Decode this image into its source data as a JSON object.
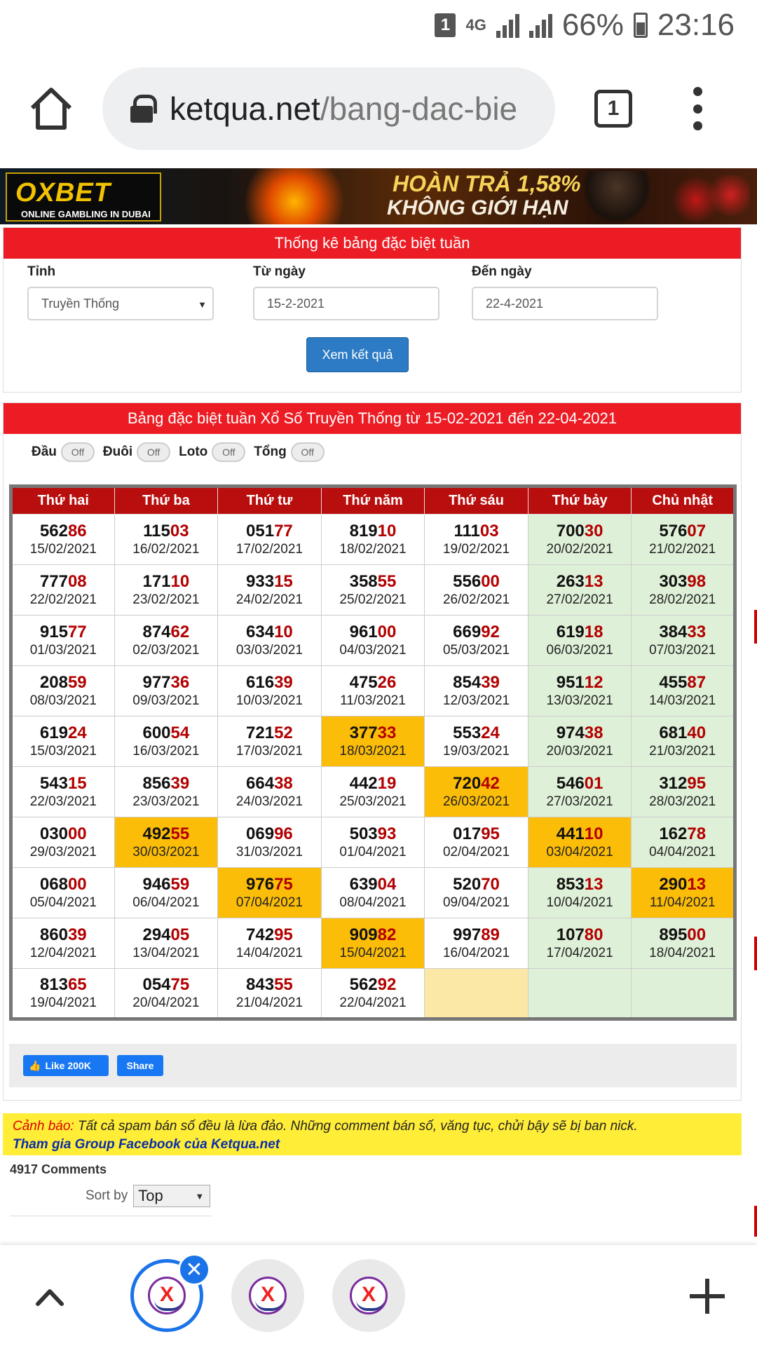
{
  "status_bar": {
    "notification_count": "1",
    "network": "4G",
    "battery": "66%",
    "time": "23:16"
  },
  "browser": {
    "url_host": "ketqua.net",
    "url_path": "/bang-dac-bie",
    "tab_count": "1"
  },
  "banner": {
    "brand": "OXBET",
    "tagline": "ONLINE GAMBLING IN DUBAI",
    "headline1": "HOÀN TRẢ 1,58%",
    "headline2": "KHÔNG GIỚI HẠN"
  },
  "filter": {
    "title": "Thống kê bảng đặc biệt tuần",
    "province_label": "Tỉnh",
    "province_value": "Truyền Thống",
    "from_label": "Từ ngày",
    "from_value": "15-2-2021",
    "to_label": "Đến ngày",
    "to_value": "22-4-2021",
    "submit_label": "Xem kết quả"
  },
  "results": {
    "title": "Bảng đặc biệt tuần Xổ Số Truyền Thống từ 15-02-2021 đến 22-04-2021",
    "toggles": [
      {
        "label": "Đầu",
        "state": "Off"
      },
      {
        "label": "Đuôi",
        "state": "Off"
      },
      {
        "label": "Loto",
        "state": "Off"
      },
      {
        "label": "Tổng",
        "state": "Off"
      }
    ],
    "headers": [
      "Thứ hai",
      "Thứ ba",
      "Thứ tư",
      "Thứ năm",
      "Thứ sáu",
      "Thứ bảy",
      "Chủ nhật"
    ],
    "rows": [
      [
        {
          "n": "56286",
          "d": "15/02/2021"
        },
        {
          "n": "11503",
          "d": "16/02/2021"
        },
        {
          "n": "05177",
          "d": "17/02/2021"
        },
        {
          "n": "81910",
          "d": "18/02/2021"
        },
        {
          "n": "11103",
          "d": "19/02/2021"
        },
        {
          "n": "70030",
          "d": "20/02/2021"
        },
        {
          "n": "57607",
          "d": "21/02/2021"
        }
      ],
      [
        {
          "n": "77708",
          "d": "22/02/2021"
        },
        {
          "n": "17110",
          "d": "23/02/2021"
        },
        {
          "n": "93315",
          "d": "24/02/2021"
        },
        {
          "n": "35855",
          "d": "25/02/2021"
        },
        {
          "n": "55600",
          "d": "26/02/2021"
        },
        {
          "n": "26313",
          "d": "27/02/2021"
        },
        {
          "n": "30398",
          "d": "28/02/2021"
        }
      ],
      [
        {
          "n": "91577",
          "d": "01/03/2021"
        },
        {
          "n": "87462",
          "d": "02/03/2021"
        },
        {
          "n": "63410",
          "d": "03/03/2021"
        },
        {
          "n": "96100",
          "d": "04/03/2021"
        },
        {
          "n": "66992",
          "d": "05/03/2021"
        },
        {
          "n": "61918",
          "d": "06/03/2021"
        },
        {
          "n": "38433",
          "d": "07/03/2021"
        }
      ],
      [
        {
          "n": "20859",
          "d": "08/03/2021"
        },
        {
          "n": "97736",
          "d": "09/03/2021"
        },
        {
          "n": "61639",
          "d": "10/03/2021"
        },
        {
          "n": "47526",
          "d": "11/03/2021"
        },
        {
          "n": "85439",
          "d": "12/03/2021"
        },
        {
          "n": "95112",
          "d": "13/03/2021"
        },
        {
          "n": "45587",
          "d": "14/03/2021"
        }
      ],
      [
        {
          "n": "61924",
          "d": "15/03/2021"
        },
        {
          "n": "60054",
          "d": "16/03/2021"
        },
        {
          "n": "72152",
          "d": "17/03/2021"
        },
        {
          "n": "37733",
          "d": "18/03/2021",
          "hl": true
        },
        {
          "n": "55324",
          "d": "19/03/2021"
        },
        {
          "n": "97438",
          "d": "20/03/2021"
        },
        {
          "n": "68140",
          "d": "21/03/2021"
        }
      ],
      [
        {
          "n": "54315",
          "d": "22/03/2021"
        },
        {
          "n": "85639",
          "d": "23/03/2021"
        },
        {
          "n": "66438",
          "d": "24/03/2021"
        },
        {
          "n": "44219",
          "d": "25/03/2021"
        },
        {
          "n": "72042",
          "d": "26/03/2021",
          "hl": true
        },
        {
          "n": "54601",
          "d": "27/03/2021"
        },
        {
          "n": "31295",
          "d": "28/03/2021"
        }
      ],
      [
        {
          "n": "03000",
          "d": "29/03/2021"
        },
        {
          "n": "49255",
          "d": "30/03/2021",
          "hl": true
        },
        {
          "n": "06996",
          "d": "31/03/2021"
        },
        {
          "n": "50393",
          "d": "01/04/2021"
        },
        {
          "n": "01795",
          "d": "02/04/2021"
        },
        {
          "n": "44110",
          "d": "03/04/2021",
          "hl": true
        },
        {
          "n": "16278",
          "d": "04/04/2021"
        }
      ],
      [
        {
          "n": "06800",
          "d": "05/04/2021"
        },
        {
          "n": "94659",
          "d": "06/04/2021"
        },
        {
          "n": "97675",
          "d": "07/04/2021",
          "hl": true
        },
        {
          "n": "63904",
          "d": "08/04/2021"
        },
        {
          "n": "52070",
          "d": "09/04/2021"
        },
        {
          "n": "85313",
          "d": "10/04/2021"
        },
        {
          "n": "29013",
          "d": "11/04/2021",
          "hl": true
        }
      ],
      [
        {
          "n": "86039",
          "d": "12/04/2021"
        },
        {
          "n": "29405",
          "d": "13/04/2021"
        },
        {
          "n": "74295",
          "d": "14/04/2021"
        },
        {
          "n": "90982",
          "d": "15/04/2021",
          "hl": true
        },
        {
          "n": "99789",
          "d": "16/04/2021"
        },
        {
          "n": "10780",
          "d": "17/04/2021"
        },
        {
          "n": "89500",
          "d": "18/04/2021"
        }
      ],
      [
        {
          "n": "81365",
          "d": "19/04/2021"
        },
        {
          "n": "05475",
          "d": "20/04/2021"
        },
        {
          "n": "84355",
          "d": "21/04/2021"
        },
        {
          "n": "56292",
          "d": "22/04/2021"
        },
        {
          "n": "",
          "d": "",
          "empty": "yellow"
        },
        {
          "n": "",
          "d": ""
        },
        {
          "n": "",
          "d": ""
        }
      ]
    ],
    "colors": {
      "header_bg": "#b90e0e",
      "weekend_bg": "#dff0d8",
      "highlight_bg": "#fcbd08",
      "tail_digits": "#b30000"
    }
  },
  "social": {
    "like_label": "Like 200K",
    "share_label": "Share"
  },
  "warning": {
    "label": "Cảnh báo:",
    "text": " Tất cả spam bán số đều là lừa đảo. Những comment bán số, văng tục, chửi bậy sẽ bị ban nick.",
    "link": "Tham gia Group Facebook của Ketqua.net"
  },
  "comments": {
    "count_label": "4917 Comments",
    "sort_label": "Sort by",
    "sort_value": "Top"
  },
  "tab_strip": {
    "icons": [
      "chevron-up-icon",
      "site-logo-icon",
      "close-icon",
      "plus-icon"
    ]
  }
}
